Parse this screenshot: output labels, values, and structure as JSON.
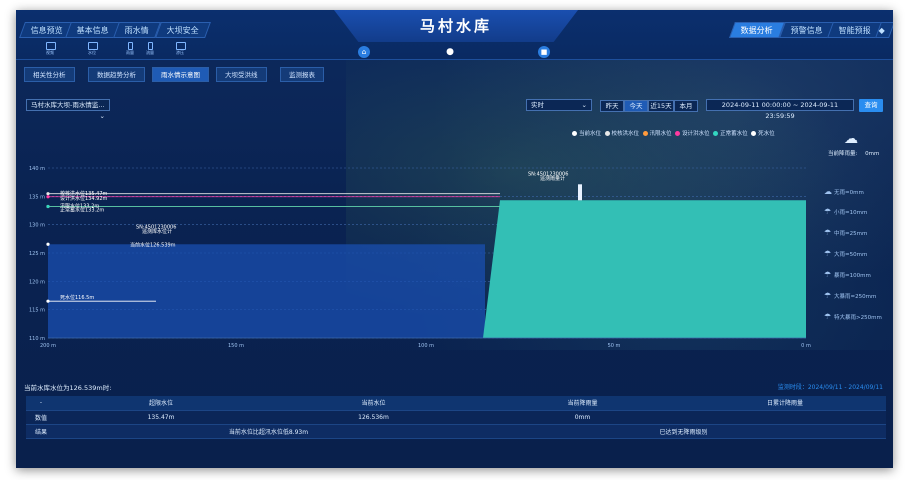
{
  "header": {
    "title": "马村水库",
    "left_tabs": [
      "信息预览",
      "基本信息",
      "雨水情",
      "大坝安全"
    ],
    "right_tabs": [
      "数据分析",
      "预警信息",
      "智能预报"
    ],
    "mini_labels": [
      "视频",
      "水位",
      "雨量",
      "流量",
      "渗压"
    ]
  },
  "subtabs": [
    "相关性分析",
    "数据趋势分析",
    "雨水情示意图",
    "大坝受洪线",
    "监测报表"
  ],
  "controls": {
    "station_select": "马村水库大坝-雨水情监...",
    "mode_select": "实时",
    "range_buttons": [
      "昨天",
      "今天",
      "近15天",
      "本月"
    ],
    "date_range": "2024-09-11 00:00:00 ~ 2024-09-11 23:59:59",
    "query_button": "查询"
  },
  "legend": [
    {
      "label": "当前水位",
      "color": "#ffffff"
    },
    {
      "label": "校核洪水位",
      "color": "#ffffff"
    },
    {
      "label": "汛限水位",
      "color": "#ff9a3c"
    },
    {
      "label": "设计洪水位",
      "color": "#ff3aa0"
    },
    {
      "label": "正常蓄水位",
      "color": "#33d6c0"
    },
    {
      "label": "死水位",
      "color": "#ffffff"
    }
  ],
  "rain": {
    "current_label": "当前降雨量:",
    "current_value": "0mm",
    "levels": [
      "无雨=0mm",
      "小雨=10mm",
      "中雨=25mm",
      "大雨=50mm",
      "暴雨=100mm",
      "大暴雨=250mm",
      "特大暴雨>250mm"
    ]
  },
  "chart_data": {
    "type": "area",
    "y_ticks": [
      "140 m",
      "135 m",
      "130 m",
      "125 m",
      "120 m",
      "115 m",
      "110 m"
    ],
    "x_ticks": [
      "200 m",
      "150 m",
      "100 m",
      "50 m",
      "0 m"
    ],
    "ylim": [
      110,
      140
    ],
    "levels": [
      {
        "name": "校核洪水位",
        "value": 135.47,
        "label": "校核洪水位135.47m",
        "color": "#e8e8e8"
      },
      {
        "name": "设计洪水位",
        "value": 134.92,
        "label": "设计洪水位134.92m",
        "color": "#ff3aa0"
      },
      {
        "name": "汛限水位",
        "value": 133.2,
        "label": "汛限水位133.2m",
        "color": "#ff9a3c"
      },
      {
        "name": "正常蓄水位",
        "value": 133.2,
        "label": "正常蓄水位133.2m",
        "color": "#33d6c0"
      },
      {
        "name": "当前水位",
        "value": 126.539,
        "label": "当前水位126.539m",
        "color": "#ffffff"
      },
      {
        "name": "死水位",
        "value": 116.5,
        "label": "死水位116.5m",
        "color": "#ffffff"
      }
    ],
    "sensor_upstream": {
      "sn": "SN:4501230006",
      "name": "遥测库水位计"
    },
    "sensor_dam": {
      "sn": "SN:4501230006",
      "name": "遥测雨量计"
    }
  },
  "bottom": {
    "summary": "当前水库水位为126.539m时:",
    "time_note": "监测时段：2024/09/11 - 2024/09/11",
    "columns": [
      "-",
      "超限水位",
      "当前水位",
      "当前降雨量",
      "日累计降雨量"
    ],
    "data_row": {
      "head": "数值",
      "cells": [
        "135.47m",
        "126.536m",
        "0mm",
        ""
      ]
    },
    "result_row": {
      "head": "结果",
      "cells": [
        "当前水位比超汛水位低8.93m",
        "已达到无降雨级别"
      ]
    }
  }
}
